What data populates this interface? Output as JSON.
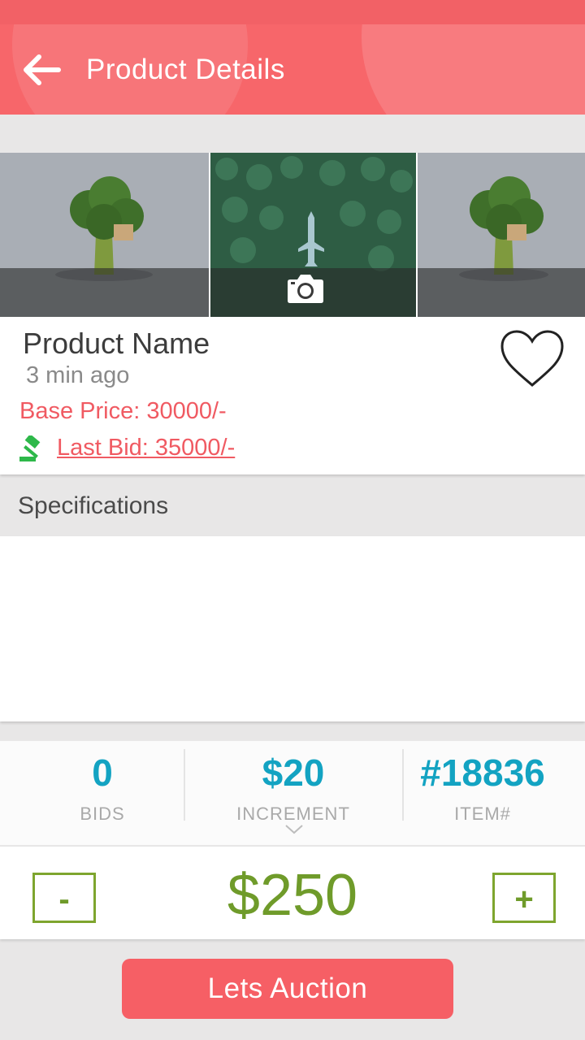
{
  "header": {
    "title": "Product Details",
    "accent_color": "#f7666a",
    "back_icon": "arrow-left-icon"
  },
  "gallery": {
    "images": [
      "broccoli-treehouse-image",
      "forest-airplane-image",
      "broccoli-treehouse-image"
    ],
    "overlay_icon": "camera-icon"
  },
  "product": {
    "name": "Product Name",
    "posted": "3 min ago",
    "base_price": "Base Price: 30000/-",
    "last_bid": "Last Bid: 35000/-",
    "price_color": "#f05a62",
    "favorite_icon": "heart-outline-icon",
    "bid_icon": "gavel-icon"
  },
  "specifications": {
    "title": "Specifications"
  },
  "stats": [
    {
      "value": "0",
      "label": "BIDS"
    },
    {
      "value": "$20",
      "label": "INCREMENT"
    },
    {
      "value": "#18836",
      "label": "ITEM#"
    }
  ],
  "bid": {
    "minus_label": "-",
    "amount": "$250",
    "plus_label": "+"
  },
  "action": {
    "label": "Lets Auction"
  }
}
